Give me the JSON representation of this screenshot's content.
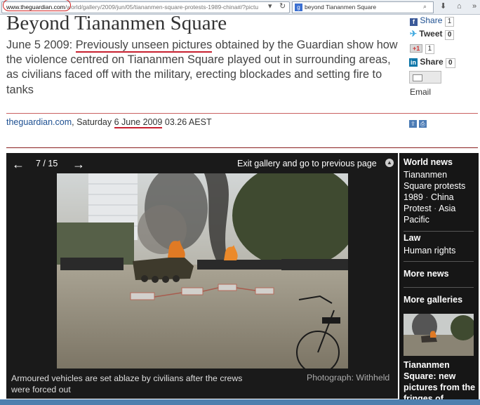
{
  "browser": {
    "url_host": "www.theguardian.com",
    "url_path": "/world/gallery/2009/jun/05/tiananmen-square-protests-1989-china#/?pictu",
    "search_query": "beyond Tiananmen Square"
  },
  "article": {
    "headline": "Beyond Tiananmen Square",
    "standfirst_date": "June 5 2009: ",
    "standfirst_highlight": "Previously unseen pictures",
    "standfirst_rest": " obtained by the Guardian show how the violence centred on Tiananmen Square played out in surrounding areas, as civilians faced off with the military, erecting blockades and setting fire to tanks",
    "byline_site": "theguardian.com",
    "byline_day": ", Saturday ",
    "byline_date": "6 June 2009",
    "byline_time": " 03.26 AEST"
  },
  "share": {
    "facebook_label": "Share",
    "facebook_count": "1",
    "twitter_label": "Tweet",
    "twitter_count": "0",
    "gplus_label": "+1",
    "gplus_count": "1",
    "linkedin_label": "Share",
    "linkedin_count": "0",
    "email_label": "Email"
  },
  "gallery": {
    "counter": "7 / 15",
    "exit_label": "Exit gallery and go to previous page",
    "caption": "Armoured vehicles are set ablaze by civilians after the crews were forced out",
    "credit": "Photograph: Withheld"
  },
  "sidebar": {
    "section1_title": "World news",
    "section1_links": [
      "Tiananmen Square protests 1989",
      "China",
      "Protest",
      "Asia Pacific"
    ],
    "section2_title": "Law",
    "section2_link": "Human rights",
    "more_news": "More news",
    "more_galleries": "More galleries",
    "gallery_title": "Tiananmen Square: new pictures from the fringes of"
  }
}
